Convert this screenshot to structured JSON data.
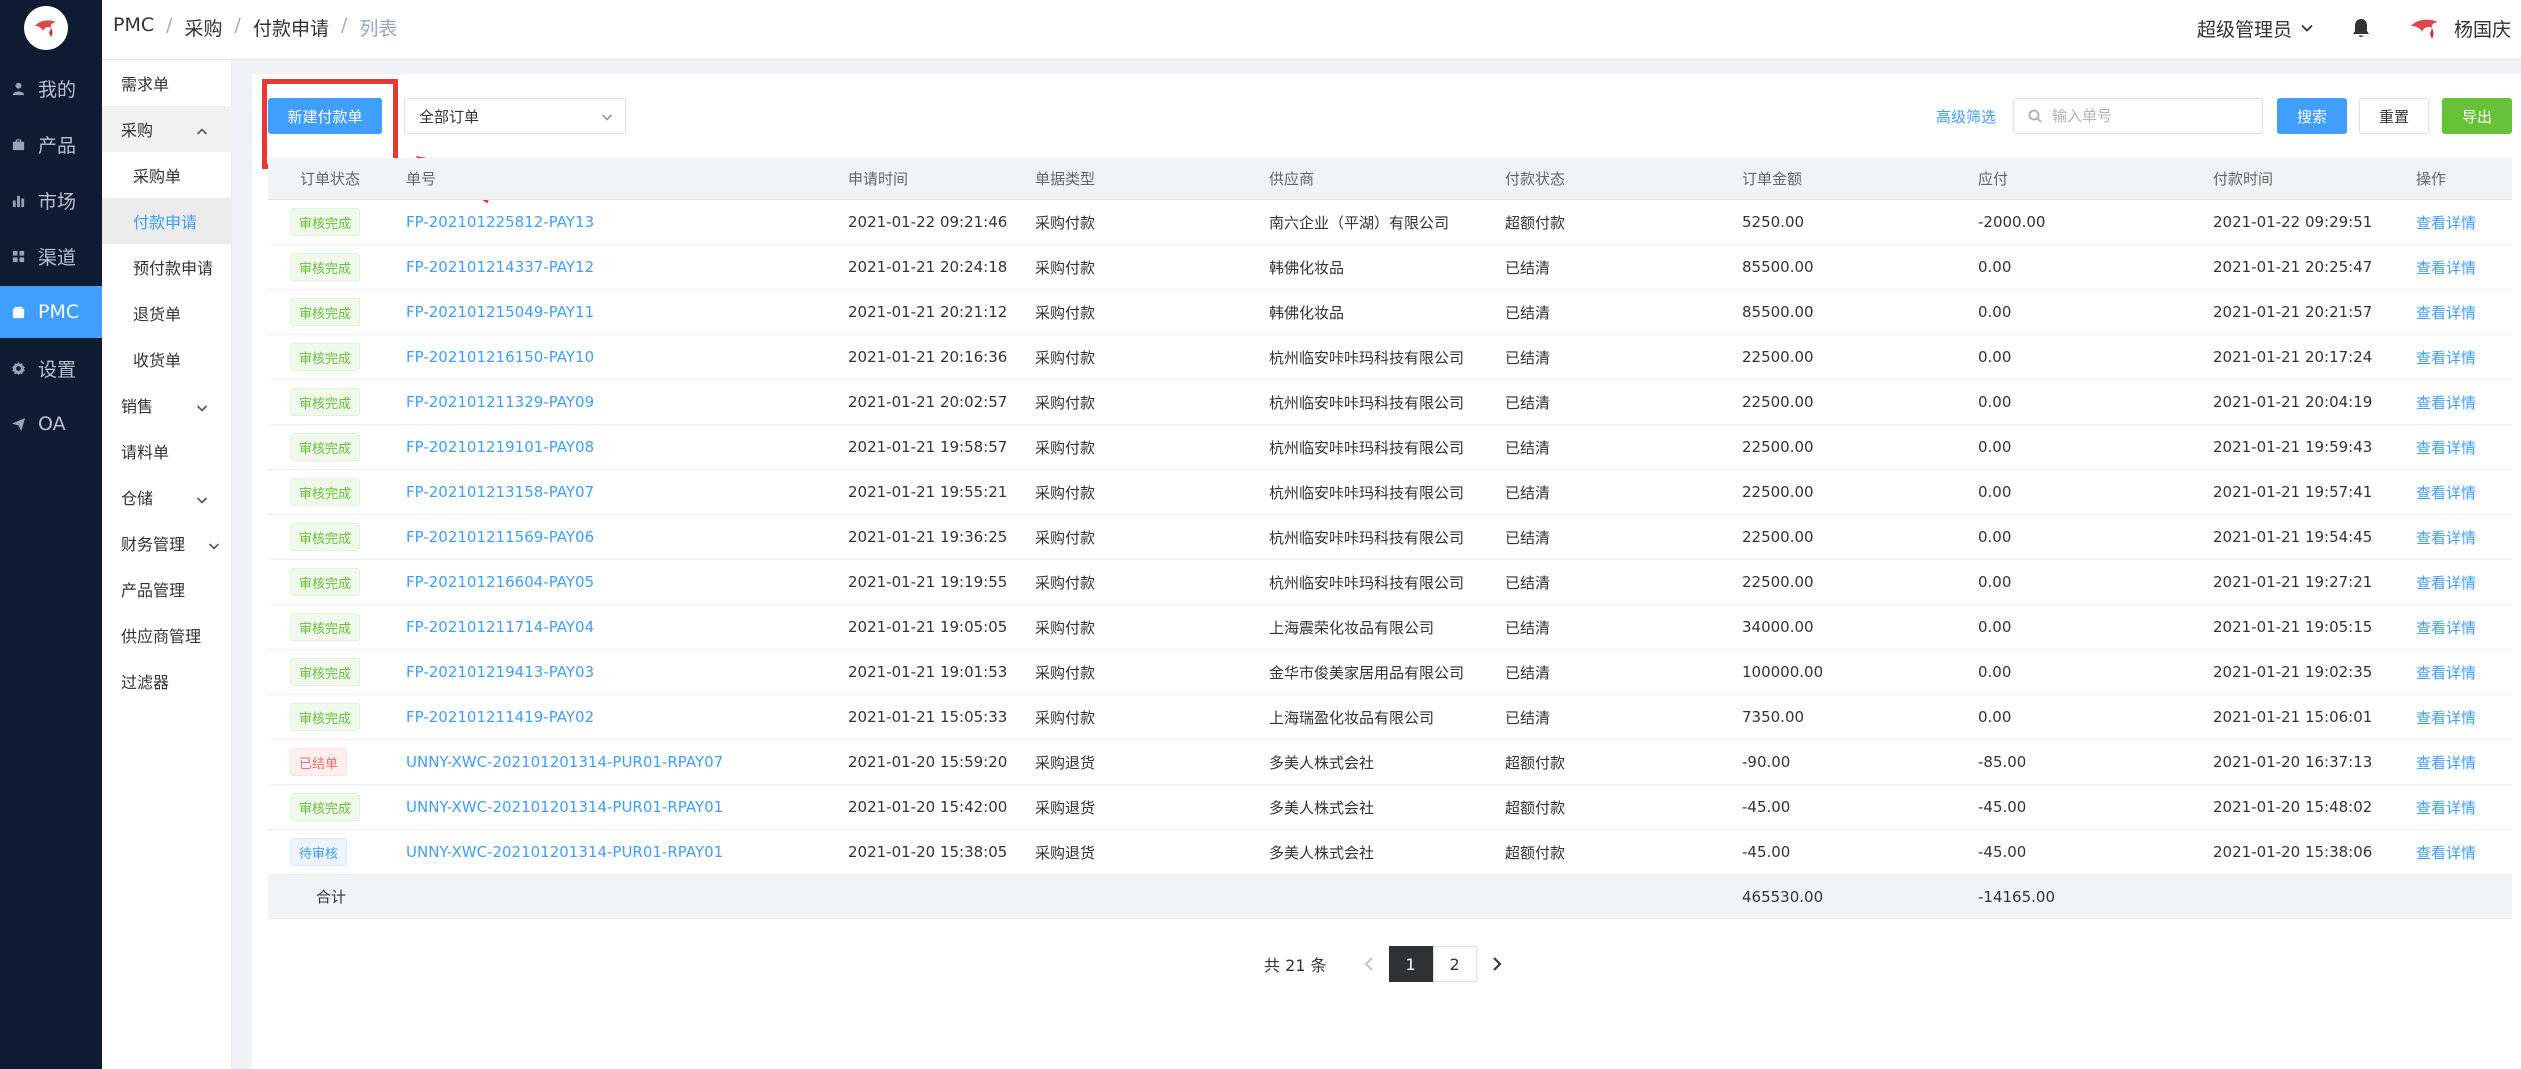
{
  "header": {
    "breadcrumbs": [
      "PMC",
      "采购",
      "付款申请",
      "列表"
    ],
    "role": "超级管理员",
    "username": "杨国庆"
  },
  "leftnav": [
    {
      "label": "我的",
      "icon": "user-icon"
    },
    {
      "label": "产品",
      "icon": "bag-icon"
    },
    {
      "label": "市场",
      "icon": "bar-chart-icon"
    },
    {
      "label": "渠道",
      "icon": "grid-icon"
    },
    {
      "label": "PMC",
      "icon": "box-icon"
    },
    {
      "label": "设置",
      "icon": "gear-icon"
    },
    {
      "label": "OA",
      "icon": "send-icon"
    }
  ],
  "subnav": {
    "demand": "需求单",
    "purchase": "采购",
    "purchase_order": "采购单",
    "payment_request": "付款申请",
    "prepay_request": "预付款申请",
    "return_order": "退货单",
    "receipt_order": "收货单",
    "sales": "销售",
    "material_request": "请料单",
    "warehouse": "仓储",
    "finance": "财务管理",
    "product_mgmt": "产品管理",
    "supplier_mgmt": "供应商管理",
    "filter": "过滤器"
  },
  "toolbar": {
    "new_label": "新建付款单",
    "order_filter": "全部订单",
    "advanced": "高级筛选",
    "search_placeholder": "输入单号",
    "search_label": "搜索",
    "reset_label": "重置",
    "export_label": "导出"
  },
  "table": {
    "columns": [
      "订单状态",
      "单号",
      "申请时间",
      "单据类型",
      "供应商",
      "付款状态",
      "订单金额",
      "应付",
      "付款时间",
      "操作"
    ],
    "rows": [
      {
        "status": "审核完成",
        "status_kind": "ok",
        "no": "FP-202101225812-PAY13",
        "time": "2021-01-22 09:21:46",
        "type": "采购付款",
        "supplier": "南六企业（平湖）有限公司",
        "pay": "超额付款",
        "amount": "5250.00",
        "due": "-2000.00",
        "ptime": "2021-01-22 09:29:51",
        "op": "查看详情"
      },
      {
        "status": "审核完成",
        "status_kind": "ok",
        "no": "FP-202101214337-PAY12",
        "time": "2021-01-21 20:24:18",
        "type": "采购付款",
        "supplier": "韩佛化妆品",
        "pay": "已结清",
        "amount": "85500.00",
        "due": "0.00",
        "ptime": "2021-01-21 20:25:47",
        "op": "查看详情"
      },
      {
        "status": "审核完成",
        "status_kind": "ok",
        "no": "FP-202101215049-PAY11",
        "time": "2021-01-21 20:21:12",
        "type": "采购付款",
        "supplier": "韩佛化妆品",
        "pay": "已结清",
        "amount": "85500.00",
        "due": "0.00",
        "ptime": "2021-01-21 20:21:57",
        "op": "查看详情"
      },
      {
        "status": "审核完成",
        "status_kind": "ok",
        "no": "FP-202101216150-PAY10",
        "time": "2021-01-21 20:16:36",
        "type": "采购付款",
        "supplier": "杭州临安咔咔玛科技有限公司",
        "pay": "已结清",
        "amount": "22500.00",
        "due": "0.00",
        "ptime": "2021-01-21 20:17:24",
        "op": "查看详情"
      },
      {
        "status": "审核完成",
        "status_kind": "ok",
        "no": "FP-202101211329-PAY09",
        "time": "2021-01-21 20:02:57",
        "type": "采购付款",
        "supplier": "杭州临安咔咔玛科技有限公司",
        "pay": "已结清",
        "amount": "22500.00",
        "due": "0.00",
        "ptime": "2021-01-21 20:04:19",
        "op": "查看详情"
      },
      {
        "status": "审核完成",
        "status_kind": "ok",
        "no": "FP-202101219101-PAY08",
        "time": "2021-01-21 19:58:57",
        "type": "采购付款",
        "supplier": "杭州临安咔咔玛科技有限公司",
        "pay": "已结清",
        "amount": "22500.00",
        "due": "0.00",
        "ptime": "2021-01-21 19:59:43",
        "op": "查看详情"
      },
      {
        "status": "审核完成",
        "status_kind": "ok",
        "no": "FP-202101213158-PAY07",
        "time": "2021-01-21 19:55:21",
        "type": "采购付款",
        "supplier": "杭州临安咔咔玛科技有限公司",
        "pay": "已结清",
        "amount": "22500.00",
        "due": "0.00",
        "ptime": "2021-01-21 19:57:41",
        "op": "查看详情"
      },
      {
        "status": "审核完成",
        "status_kind": "ok",
        "no": "FP-202101211569-PAY06",
        "time": "2021-01-21 19:36:25",
        "type": "采购付款",
        "supplier": "杭州临安咔咔玛科技有限公司",
        "pay": "已结清",
        "amount": "22500.00",
        "due": "0.00",
        "ptime": "2021-01-21 19:54:45",
        "op": "查看详情"
      },
      {
        "status": "审核完成",
        "status_kind": "ok",
        "no": "FP-202101216604-PAY05",
        "time": "2021-01-21 19:19:55",
        "type": "采购付款",
        "supplier": "杭州临安咔咔玛科技有限公司",
        "pay": "已结清",
        "amount": "22500.00",
        "due": "0.00",
        "ptime": "2021-01-21 19:27:21",
        "op": "查看详情"
      },
      {
        "status": "审核完成",
        "status_kind": "ok",
        "no": "FP-202101211714-PAY04",
        "time": "2021-01-21 19:05:05",
        "type": "采购付款",
        "supplier": "上海震荣化妆品有限公司",
        "pay": "已结清",
        "amount": "34000.00",
        "due": "0.00",
        "ptime": "2021-01-21 19:05:15",
        "op": "查看详情"
      },
      {
        "status": "审核完成",
        "status_kind": "ok",
        "no": "FP-202101219413-PAY03",
        "time": "2021-01-21 19:01:53",
        "type": "采购付款",
        "supplier": "金华市俊美家居用品有限公司",
        "pay": "已结清",
        "amount": "100000.00",
        "due": "0.00",
        "ptime": "2021-01-21 19:02:35",
        "op": "查看详情"
      },
      {
        "status": "审核完成",
        "status_kind": "ok",
        "no": "FP-202101211419-PAY02",
        "time": "2021-01-21 15:05:33",
        "type": "采购付款",
        "supplier": "上海瑞盈化妆品有限公司",
        "pay": "已结清",
        "amount": "7350.00",
        "due": "0.00",
        "ptime": "2021-01-21 15:06:01",
        "op": "查看详情"
      },
      {
        "status": "已结单",
        "status_kind": "bad",
        "no": "UNNY-XWC-202101201314-PUR01-RPAY07",
        "time": "2021-01-20 15:59:20",
        "type": "采购退货",
        "supplier": "多美人株式会社",
        "pay": "超额付款",
        "amount": "-90.00",
        "due": "-85.00",
        "ptime": "2021-01-20 16:37:13",
        "op": "查看详情"
      },
      {
        "status": "审核完成",
        "status_kind": "ok",
        "no": "UNNY-XWC-202101201314-PUR01-RPAY01",
        "time": "2021-01-20 15:42:00",
        "type": "采购退货",
        "supplier": "多美人株式会社",
        "pay": "超额付款",
        "amount": "-45.00",
        "due": "-45.00",
        "ptime": "2021-01-20 15:48:02",
        "op": "查看详情"
      },
      {
        "status": "待审核",
        "status_kind": "wait",
        "no": "UNNY-XWC-202101201314-PUR01-RPAY01",
        "time": "2021-01-20 15:38:05",
        "type": "采购退货",
        "supplier": "多美人株式会社",
        "pay": "超额付款",
        "amount": "-45.00",
        "due": "-45.00",
        "ptime": "2021-01-20 15:38:06",
        "op": "查看详情"
      }
    ],
    "total": {
      "label": "合计",
      "amount": "465530.00",
      "due": "-14165.00"
    }
  },
  "pagination": {
    "total_text": "共 21 条",
    "pages": [
      "1",
      "2"
    ],
    "current": "1"
  },
  "colors": {
    "primary": "#409eff",
    "success": "#67c23a",
    "danger": "#f56c6c",
    "nav_bg": "#0f1a33",
    "annotation": "#e53935"
  }
}
